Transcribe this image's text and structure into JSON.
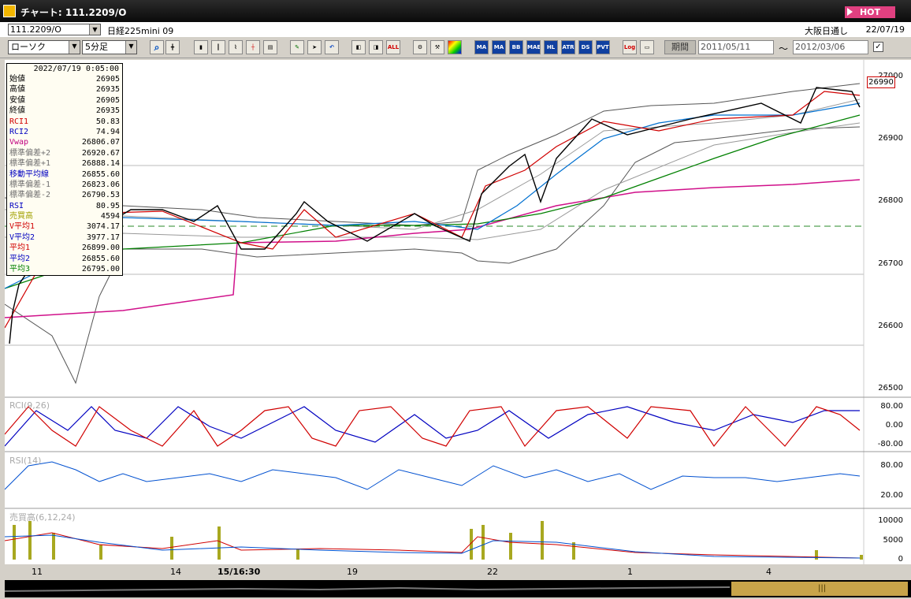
{
  "window": {
    "title": "チャート: 111.2209/O",
    "hot_label": "HOT"
  },
  "header": {
    "symbol": "111.2209/O",
    "instrument": "日経225mini 09",
    "market": "大阪日通し",
    "market_date": "22/07/19"
  },
  "toolbar": {
    "chart_type": "ローソク",
    "interval": "5分足",
    "period_label": "期間",
    "date_from": "2011/05/11",
    "date_to": "2012/03/06",
    "tilde": "～",
    "check_mark": "✓",
    "indicator_buttons": [
      "MA",
      "BB",
      "MAE",
      "HL",
      "ATR",
      "DS",
      "PVT"
    ],
    "log_label": "Log",
    "all_label": "ALL"
  },
  "info_panel": {
    "timestamp": "2022/07/19 0:05:00",
    "rows": [
      {
        "label": "始値",
        "value": "26905",
        "color": "#000000"
      },
      {
        "label": "高値",
        "value": "26935",
        "color": "#000000"
      },
      {
        "label": "安値",
        "value": "26905",
        "color": "#000000"
      },
      {
        "label": "終値",
        "value": "26935",
        "color": "#000000"
      },
      {
        "label": "RCI1",
        "value": "50.83",
        "color": "#d00000"
      },
      {
        "label": "RCI2",
        "value": "74.94",
        "color": "#0000c0"
      },
      {
        "label": "Vwap",
        "value": "26806.07",
        "color": "#c00080"
      },
      {
        "label": "標準偏差+2",
        "value": "26920.67",
        "color": "#707070"
      },
      {
        "label": "標準偏差+1",
        "value": "26888.14",
        "color": "#707070"
      },
      {
        "label": "移動平均線",
        "value": "26855.60",
        "color": "#0000c0"
      },
      {
        "label": "標準偏差-1",
        "value": "26823.06",
        "color": "#707070"
      },
      {
        "label": "標準偏差-2",
        "value": "26790.53",
        "color": "#707070"
      },
      {
        "label": "RSI",
        "value": "80.95",
        "color": "#0000c0"
      },
      {
        "label": "売買高",
        "value": "4594",
        "color": "#a0a000"
      },
      {
        "label": "V平均1",
        "value": "3074.17",
        "color": "#d00000"
      },
      {
        "label": "V平均2",
        "value": "3977.17",
        "color": "#0000c0"
      },
      {
        "label": "平均1",
        "value": "26899.00",
        "color": "#d00000"
      },
      {
        "label": "平均2",
        "value": "26855.60",
        "color": "#0000c0"
      },
      {
        "label": "平均3",
        "value": "26795.00",
        "color": "#008000"
      }
    ]
  },
  "price_panel": {
    "y_ticks": [
      "27000",
      "26900",
      "26800",
      "26700",
      "26600",
      "26500"
    ],
    "last_price": "26990"
  },
  "rci_panel": {
    "label": "RCI(9,26)",
    "y_ticks": [
      "80.00",
      "0.00",
      "-80.00"
    ]
  },
  "rsi_panel": {
    "label": "RSI(14)",
    "y_ticks": [
      "80.00",
      "20.00"
    ]
  },
  "volume_panel": {
    "label": "売買高(6,12,24)",
    "y_ticks": [
      "10000",
      "5000",
      "0"
    ]
  },
  "x_axis": {
    "labels": [
      "11",
      "14",
      "15/16:30",
      "19",
      "22",
      "1",
      "4"
    ]
  },
  "scrollbar": {
    "grip": "|||"
  }
}
